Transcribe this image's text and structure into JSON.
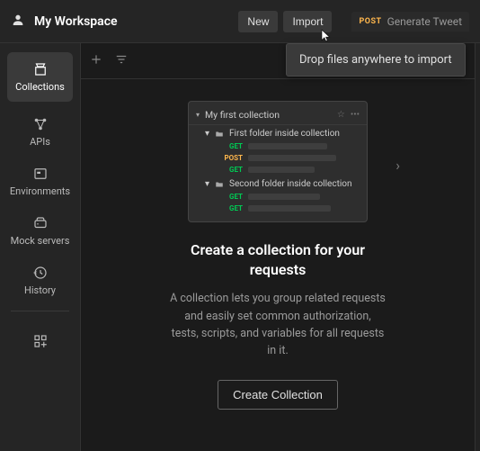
{
  "header": {
    "workspace": "My Workspace",
    "new_label": "New",
    "import_label": "Import",
    "tab_method": "POST",
    "tab_title": "Generate Tweet",
    "tooltip": "Drop files anywhere to import"
  },
  "sidebar": {
    "items": [
      {
        "label": "Collections",
        "icon": "collections"
      },
      {
        "label": "APIs",
        "icon": "apis"
      },
      {
        "label": "Environments",
        "icon": "environments"
      },
      {
        "label": "Mock servers",
        "icon": "mock"
      },
      {
        "label": "History",
        "icon": "history"
      }
    ]
  },
  "toolbar": {
    "plus": "+",
    "filter": "filter"
  },
  "illustration": {
    "title": "My first collection",
    "folders": [
      {
        "name": "First folder inside collection",
        "requests": [
          {
            "method": "GET"
          },
          {
            "method": "POST"
          },
          {
            "method": "GET"
          }
        ]
      },
      {
        "name": "Second folder inside collection",
        "requests": [
          {
            "method": "GET"
          },
          {
            "method": "GET"
          }
        ]
      }
    ]
  },
  "empty": {
    "heading": "Create a collection for your requests",
    "body": "A collection lets you group related requests and easily set common authorization, tests, scripts, and variables for all requests in it.",
    "cta": "Create Collection"
  }
}
